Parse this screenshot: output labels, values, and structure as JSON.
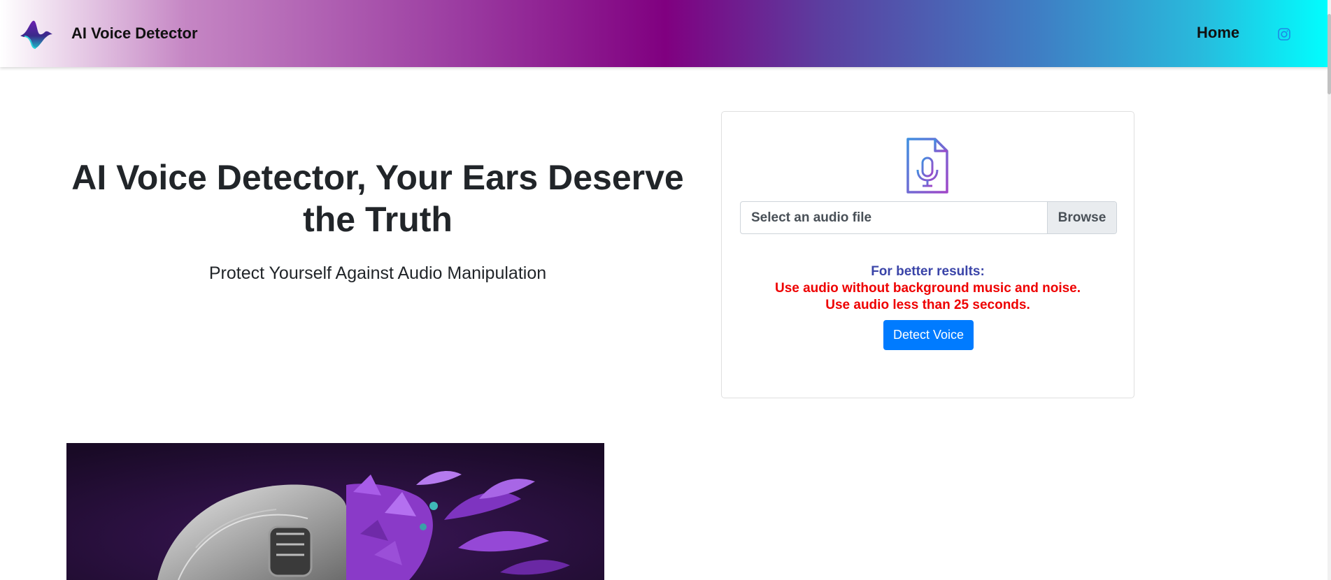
{
  "navbar": {
    "brand_text": "AI Voice Detector",
    "home_label": "Home",
    "instagram_icon": "instagram-icon",
    "colors": {
      "left": "#ffffff",
      "middle": "#800080",
      "right": "#00ffff"
    }
  },
  "hero": {
    "title": "AI Voice Detector, Your Ears Deserve the Truth",
    "subtitle": "Protect Yourself Against Audio Manipulation"
  },
  "upload_card": {
    "icon": "audio-file-icon",
    "file_placeholder": "Select an audio file",
    "browse_label": "Browse",
    "tips_heading": "For better results:",
    "tip_1": "Use audio without background music and noise.",
    "tip_2": "Use audio less than 25 seconds.",
    "detect_button": "Detect Voice",
    "colors": {
      "heading": "#3a44a8",
      "tips": "#ee0000",
      "button": "#007bff"
    }
  }
}
